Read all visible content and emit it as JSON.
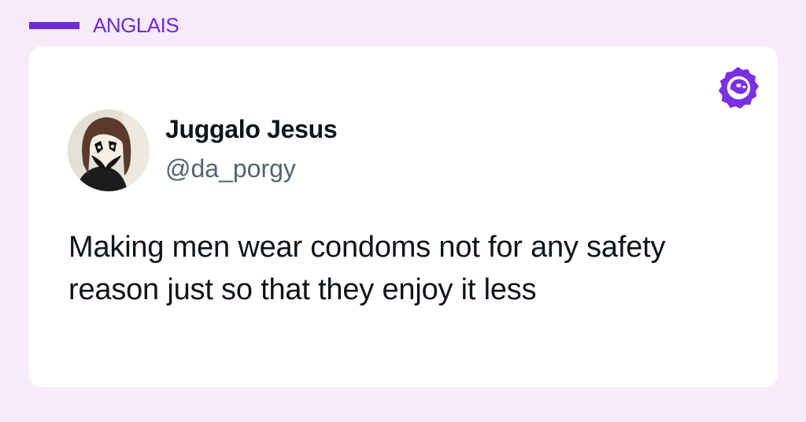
{
  "category": {
    "label": "ANGLAIS"
  },
  "tweet": {
    "author_name": "Juggalo Jesus",
    "handle": "@da_porgy",
    "text": "Making men wear condoms not for any safety reason just so that they enjoy it less"
  },
  "colors": {
    "page_background": "#f8e9fb",
    "accent": "#6c2bd9",
    "card_background": "#ffffff",
    "name_text": "#0f1419",
    "handle_text": "#536471"
  },
  "icons": {
    "brand": "ghost-bubble-logo-icon"
  }
}
